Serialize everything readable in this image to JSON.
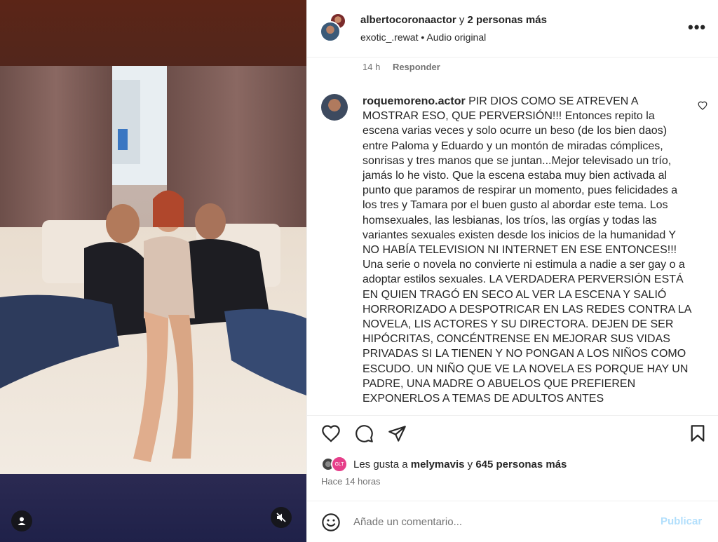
{
  "post": {
    "author": "albertocoronaactor",
    "coauthors_text": "y",
    "coauthors_count": "2 personas más",
    "audio_user": "exotic_.rewat",
    "audio_sep": "•",
    "audio_label": "Audio original",
    "more_label": "•••"
  },
  "previous_comment_meta": {
    "time": "14 h",
    "reply": "Responder"
  },
  "comment": {
    "username": "roquemoreno.actor",
    "text": "PIR DIOS COMO SE ATREVEN A MOSTRAR ESO, QUE PERVERSIÓN!!! Entonces repito la escena varias veces y solo ocurre un beso (de los bien daos) entre Paloma y Eduardo y un montón de miradas cómplices, sonrisas y tres manos que se juntan...Mejor televisado un trío, jamás lo he visto. Que la escena estaba muy bien activada al punto que paramos de respirar un momento, pues felicidades a los tres y Tamara por el buen gusto al abordar este tema. Los homsexuales, las lesbianas, los tríos, las orgías y todas las variantes sexuales existen desde los inicios de la humanidad Y NO HABÍA TELEVISION NI INTERNET EN ESE ENTONCES!!! Una serie o novela no convierte ni estimula a nadie a ser gay o a adoptar estilos sexuales. LA VERDADERA PERVERSIÓN ESTÁ EN QUIEN TRAGÓ EN SECO AL VER LA ESCENA Y SALIÓ HORRORIZADO A DESPOTRICAR EN LAS REDES CONTRA LA NOVELA, LIS ACTORES Y SU DIRECTORA. DEJEN DE SER HIPÓCRITAS, CONCÉNTRENSE EN MEJORAR SUS VIDAS PRIVADAS SI LA TIENEN Y NO PONGAN A LOS NIÑOS COMO ESCUDO. UN NIÑO QUE VE LA NOVELA ES PORQUE HAY UN PADRE, UNA MADRE O ABUELOS QUE PREFIEREN EXPONERLOS A TEMAS DE ADULTOS ANTES"
  },
  "likes": {
    "prefix": "Les gusta a",
    "user": "melymavis",
    "connector": "y",
    "count": "645 personas más",
    "badge_text": "GLT"
  },
  "time_ago": "Hace 14 horas",
  "add_comment": {
    "placeholder": "Añade un comentario...",
    "publish": "Publicar"
  },
  "icons": {
    "like": "heart-icon",
    "comment": "comment-bubble-icon",
    "share": "paper-plane-icon",
    "save": "bookmark-icon",
    "emoji": "smiley-icon",
    "user": "user-icon",
    "mute": "muted-speaker-icon"
  },
  "colors": {
    "text": "#262626",
    "secondary": "#737373",
    "publish_disabled": "#b2dffc",
    "divider": "#efefef"
  }
}
